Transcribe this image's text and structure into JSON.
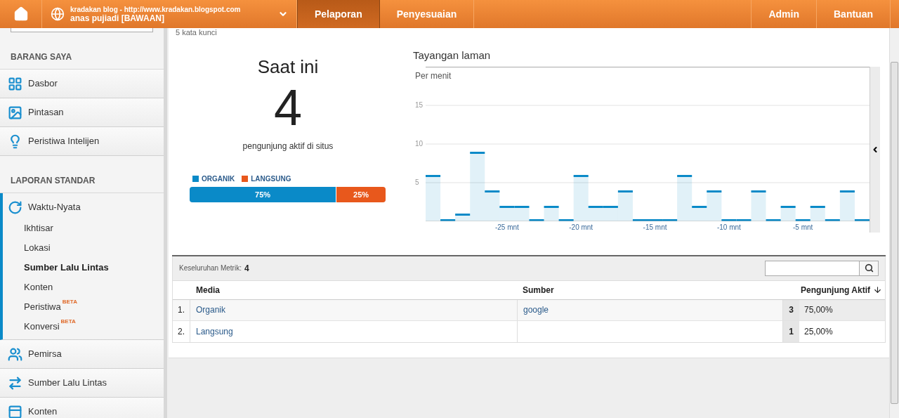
{
  "header": {
    "account": {
      "site": "kradakan blog - http://www.kradakan.blogspot.com",
      "view": "anas pujiadi [BAWAAN]"
    },
    "nav": [
      {
        "label": "Pelaporan",
        "selected": true
      },
      {
        "label": "Penyesuaian",
        "selected": false
      }
    ],
    "right_nav": [
      "Admin",
      "Bantuan"
    ]
  },
  "sidebar": {
    "sections": [
      {
        "heading": "BARANG SAYA",
        "items": [
          {
            "label": "Dasbor",
            "expanded": false
          },
          {
            "label": "Pintasan",
            "expanded": false
          },
          {
            "label": "Peristiwa Intelijen",
            "expanded": false
          }
        ]
      },
      {
        "heading": "LAPORAN STANDAR",
        "items": [
          {
            "label": "Waktu-Nyata",
            "expanded": true,
            "children": [
              {
                "label": "Ikhtisar",
                "selected": false
              },
              {
                "label": "Lokasi",
                "selected": false
              },
              {
                "label": "Sumber Lalu Lintas",
                "selected": true
              },
              {
                "label": "Konten",
                "selected": false
              },
              {
                "label": "Peristiwa",
                "selected": false,
                "badge": "BETA"
              },
              {
                "label": "Konversi",
                "selected": false,
                "badge": "BETA"
              }
            ]
          },
          {
            "label": "Pemirsa",
            "expanded": false
          },
          {
            "label": "Sumber Lalu Lintas",
            "expanded": false
          },
          {
            "label": "Konten",
            "expanded": false
          }
        ]
      }
    ]
  },
  "keywords": "5 kata kunci",
  "now": {
    "title": "Saat ini",
    "count": "4",
    "caption": "pengunjung aktif di situs",
    "legend": [
      {
        "label": "ORGANIK",
        "color": "#0a8ac8"
      },
      {
        "label": "LANGSUNG",
        "color": "#e8581c"
      }
    ],
    "segments": [
      {
        "label": "75%",
        "level": 0.75,
        "color": "#0a8ac8"
      },
      {
        "label": "25%",
        "level": 0.25,
        "color": "#e8581c"
      }
    ]
  },
  "pageviews": {
    "title": "Tayangan laman",
    "subtitle": "Per menit",
    "chart_data": {
      "type": "bar",
      "x": [
        -30,
        -29,
        -28,
        -27,
        -26,
        -25,
        -24,
        -23,
        -22,
        -21,
        -20,
        -19,
        -18,
        -17,
        -16,
        -15,
        -14,
        -13,
        -12,
        -11,
        -10,
        -9,
        -8,
        -7,
        -6,
        -5,
        -4,
        -3,
        -2,
        -1
      ],
      "series": [
        {
          "color": "#0a8ac8",
          "values": [
            6,
            0,
            1,
            9,
            4,
            2,
            2,
            0,
            2,
            0,
            6,
            2,
            2,
            4,
            0,
            0,
            0,
            6,
            2,
            4,
            0,
            0,
            4,
            0,
            2,
            0,
            2,
            0,
            4,
            0
          ]
        }
      ],
      "xlim": [
        -30.5,
        -0.5
      ],
      "ylim": [
        0,
        20
      ],
      "grid": true,
      "yticks": [
        {
          "value": 5,
          "label": "5"
        },
        {
          "value": 10,
          "label": "10"
        },
        {
          "value": 15,
          "label": "15"
        }
      ],
      "xticks": [
        {
          "value": -25,
          "label": "-25 mnt"
        },
        {
          "value": -20,
          "label": "-20 mnt"
        },
        {
          "value": -15,
          "label": "-15 mnt"
        },
        {
          "value": -10,
          "label": "-10 mnt"
        },
        {
          "value": -5,
          "label": "-5 mnt"
        }
      ]
    }
  },
  "table": {
    "metric_label": "Keseluruhan Metrik:",
    "metric_value": "4",
    "columns": [
      "Media",
      "Sumber",
      "Pengunjung Aktif"
    ],
    "rows": [
      {
        "index": "1.",
        "media": "Organik",
        "source": "google",
        "count": "3",
        "share": "75,00%"
      },
      {
        "index": "2.",
        "media": "Langsung",
        "count": "1",
        "share": "25,00%"
      }
    ]
  }
}
